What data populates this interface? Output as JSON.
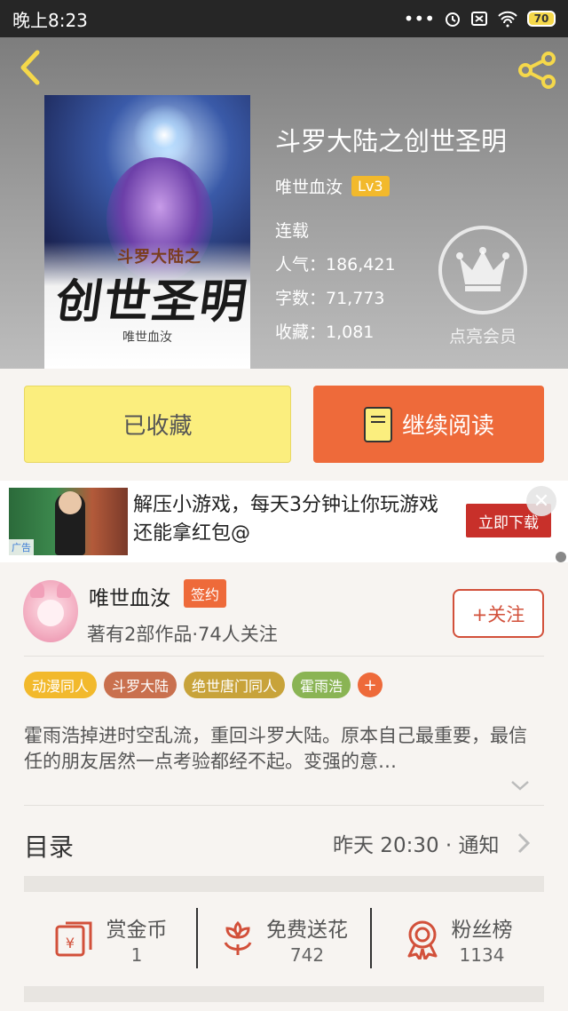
{
  "status_bar": {
    "time": "晚上8:23",
    "battery": "70"
  },
  "book": {
    "title": "斗罗大陆之创世圣明",
    "author": "唯世血汝",
    "level": "Lv3",
    "status": "连载",
    "popularity": "人气：186,421",
    "word_count": "字数：71,773",
    "favorites": "收藏：1,081",
    "cover": {
      "subtitle": "斗罗大陆之",
      "main": "创世圣明",
      "author": "唯世血汝"
    }
  },
  "vip": {
    "label": "点亮会员"
  },
  "buttons": {
    "collected": "已收藏",
    "continue_reading": "继续阅读"
  },
  "ad": {
    "text": "解压小游戏，每天3分钟让你玩游戏还能拿红包@",
    "cta": "立即下载",
    "tag": "广告",
    "close": "✕"
  },
  "author_card": {
    "name": "唯世血汝",
    "badge": "签约",
    "meta": "著有2部作品·74人关注",
    "follow": "+关注"
  },
  "tags": [
    {
      "label": "动漫同人",
      "color": "#f2b92c"
    },
    {
      "label": "斗罗大陆",
      "color": "#c9704e"
    },
    {
      "label": "绝世唐门同人",
      "color": "#c8a33a"
    },
    {
      "label": "霍雨浩",
      "color": "#8ab454"
    }
  ],
  "tag_plus": "+",
  "description": "霍雨浩掉进时空乱流，重回斗罗大陆。原本自己最重要，最信任的朋友居然一点考验都经不起。变强的意…",
  "toc": {
    "title": "目录",
    "update": "昨天 20:30 · 通知"
  },
  "actions": [
    {
      "label": "赏金币",
      "count": "1",
      "icon": "reward-coin-icon"
    },
    {
      "label": "免费送花",
      "count": "742",
      "icon": "flower-icon"
    },
    {
      "label": "粉丝榜",
      "count": "1134",
      "icon": "medal-icon"
    }
  ],
  "accent_color": "#ee6a3a"
}
